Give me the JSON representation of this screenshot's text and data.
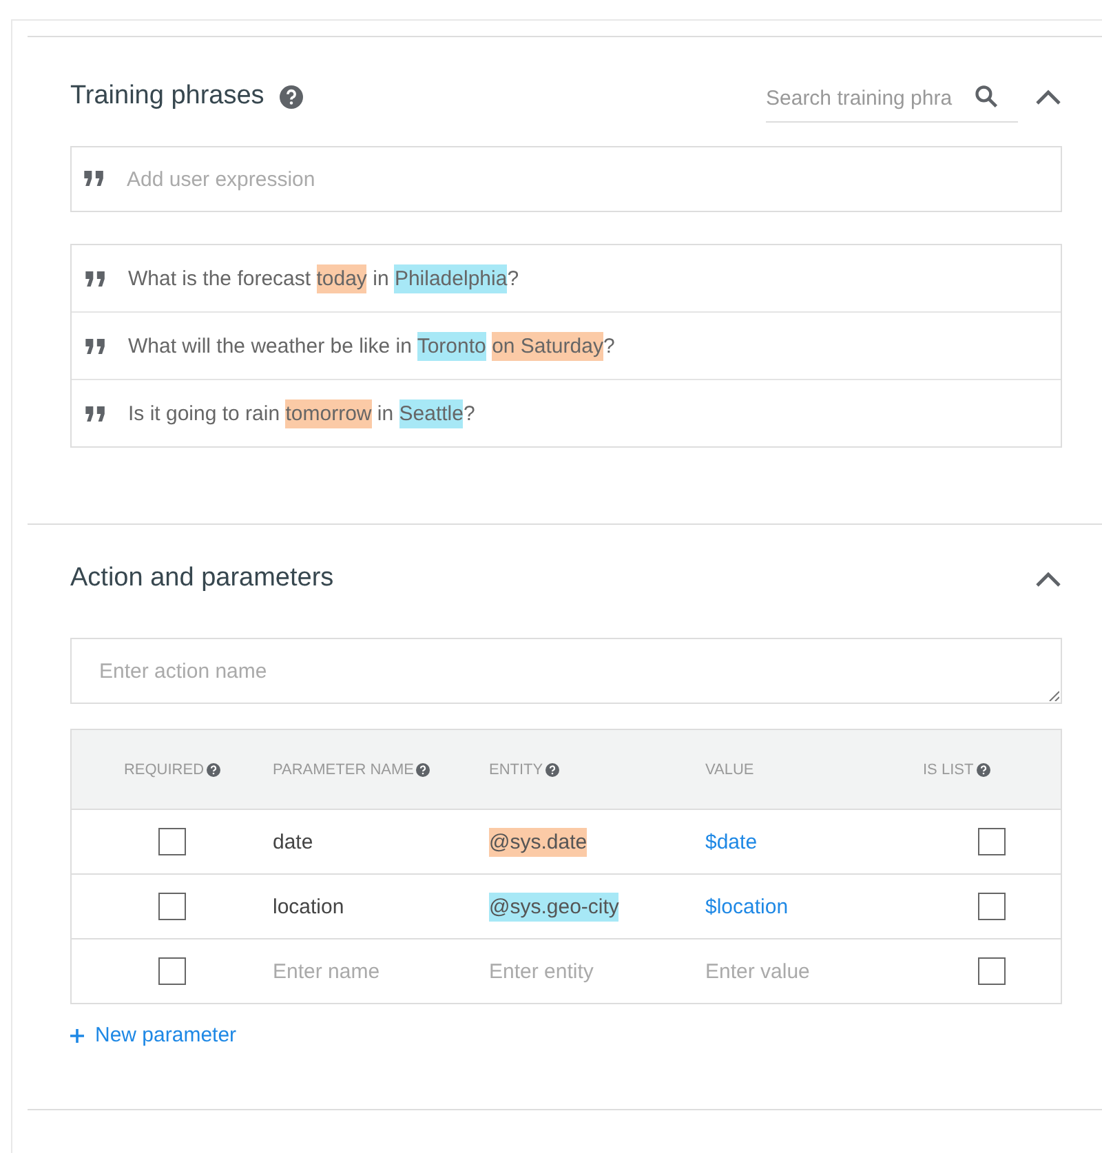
{
  "training_phrases": {
    "title": "Training phrases",
    "search": {
      "placeholder": "Search training phra"
    },
    "add_field": {
      "placeholder": "Add user expression"
    },
    "phrases": [
      {
        "parts": [
          {
            "text": "What is the forecast "
          },
          {
            "text": "today",
            "color": "#fbcaa6"
          },
          {
            "text": " in "
          },
          {
            "text": "Philadelphia",
            "color": "#a7e8f6"
          },
          {
            "text": "?"
          }
        ]
      },
      {
        "parts": [
          {
            "text": "What will the weather be like in "
          },
          {
            "text": "Toronto",
            "color": "#a7e8f6"
          },
          {
            "text": "on Saturday",
            "color": "#fbcaa6",
            "gap": true
          },
          {
            "text": "?"
          }
        ]
      },
      {
        "parts": [
          {
            "text": "Is it going to rain "
          },
          {
            "text": "tomorrow",
            "color": "#fbcaa6"
          },
          {
            "text": " in "
          },
          {
            "text": "Seattle",
            "color": "#a7e8f6"
          },
          {
            "text": "?"
          }
        ]
      }
    ]
  },
  "action_and_parameters": {
    "title": "Action and parameters",
    "action_field": {
      "placeholder": "Enter action name"
    },
    "columns": [
      {
        "label": "REQUIRED",
        "help": true
      },
      {
        "label": "PARAMETER NAME",
        "help": true
      },
      {
        "label": "ENTITY",
        "help": true
      },
      {
        "label": "VALUE",
        "help": false
      },
      {
        "label": "IS LIST",
        "help": true
      }
    ],
    "rows": [
      {
        "required": false,
        "name": "date",
        "entity": "@sys.date",
        "color": "#fbcaa6",
        "value": "$date",
        "is_list": false
      },
      {
        "required": false,
        "name": "location",
        "entity": "@sys.geo-city",
        "color": "#a7e8f6",
        "value": "$location",
        "is_list": false
      },
      {
        "required": false,
        "name_placeholder": "Enter name",
        "entity_placeholder": "Enter entity",
        "value_placeholder": "Enter value",
        "is_list": false
      }
    ],
    "new_parameter": "New parameter"
  }
}
